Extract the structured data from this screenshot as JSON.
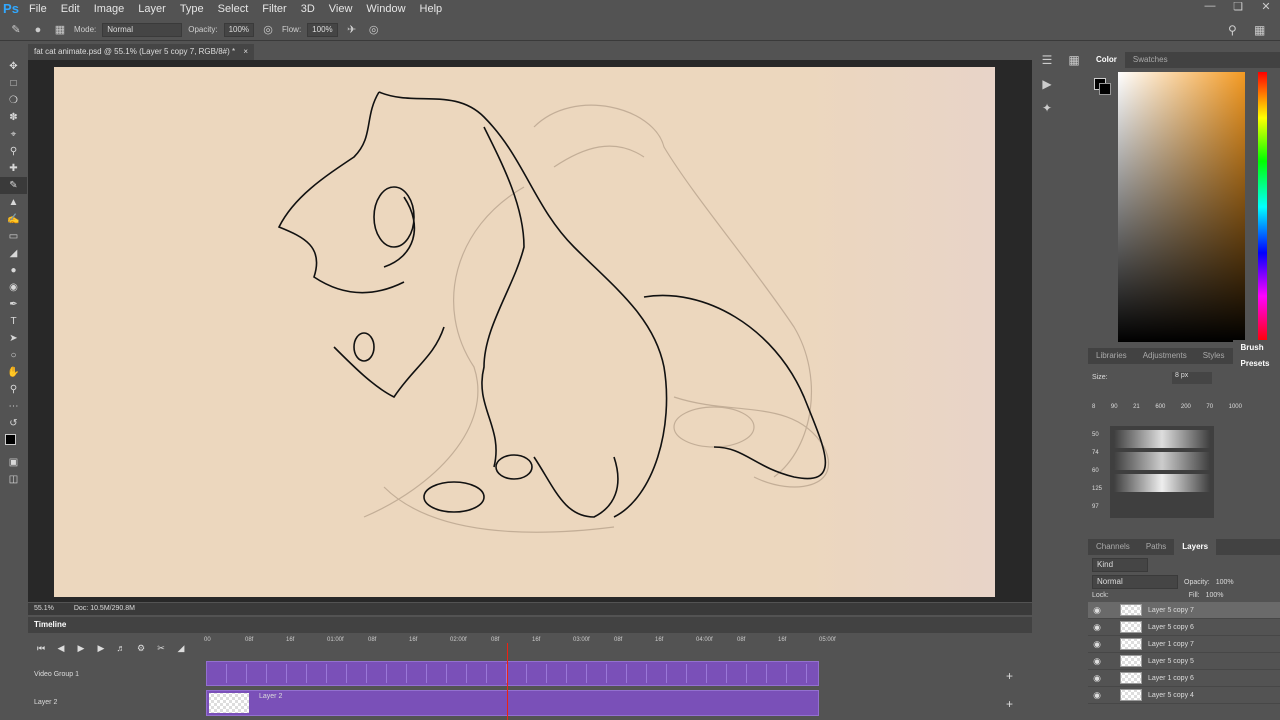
{
  "app": {
    "logo": "Ps"
  },
  "menu": [
    "File",
    "Edit",
    "Image",
    "Layer",
    "Type",
    "Select",
    "Filter",
    "3D",
    "View",
    "Window",
    "Help"
  ],
  "options": {
    "mode_label": "Mode:",
    "mode_value": "Normal",
    "opacity_label": "Opacity:",
    "opacity_value": "100%",
    "flow_label": "Flow:",
    "flow_value": "100%"
  },
  "document": {
    "tab_title": "fat cat animate.psd @ 55.1% (Layer 5 copy 7, RGB/8#) *",
    "zoom": "55.1%",
    "doc_size": "Doc: 10.5M/290.8M"
  },
  "color_panel": {
    "tabs": [
      "Color",
      "Swatches"
    ]
  },
  "brush_panel": {
    "tabs": [
      "Libraries",
      "Adjustments",
      "Styles",
      "Brush Presets"
    ],
    "size_label": "Size:",
    "size_value": "8 px",
    "presets": [
      "8",
      "90",
      "21",
      "600",
      "200",
      "70",
      "1000"
    ],
    "list_sizes": [
      "50",
      "74",
      "60",
      "125",
      "97"
    ]
  },
  "layers_panel": {
    "tabs": [
      "Channels",
      "Paths",
      "Layers"
    ],
    "kind": "Kind",
    "blend": "Normal",
    "opacity_label": "Opacity:",
    "opacity": "100%",
    "lock_label": "Lock:",
    "fill_label": "Fill:",
    "fill": "100%",
    "layers": [
      {
        "name": "Layer 5 copy 7"
      },
      {
        "name": "Layer 5 copy 6"
      },
      {
        "name": "Layer 1 copy 7"
      },
      {
        "name": "Layer 5 copy 5"
      },
      {
        "name": "Layer 1 copy 6"
      },
      {
        "name": "Layer 5 copy 4"
      }
    ]
  },
  "timeline": {
    "title": "Timeline",
    "ruler": [
      "00",
      "08f",
      "16f",
      "01:00f",
      "08f",
      "16f",
      "02:00f",
      "08f",
      "16f",
      "03:00f",
      "08f",
      "16f",
      "04:00f",
      "08f",
      "16f",
      "05:00f"
    ],
    "tracks": [
      {
        "name": "Video Group 1"
      },
      {
        "name": "Layer 2",
        "clip": "Layer 2"
      }
    ]
  }
}
